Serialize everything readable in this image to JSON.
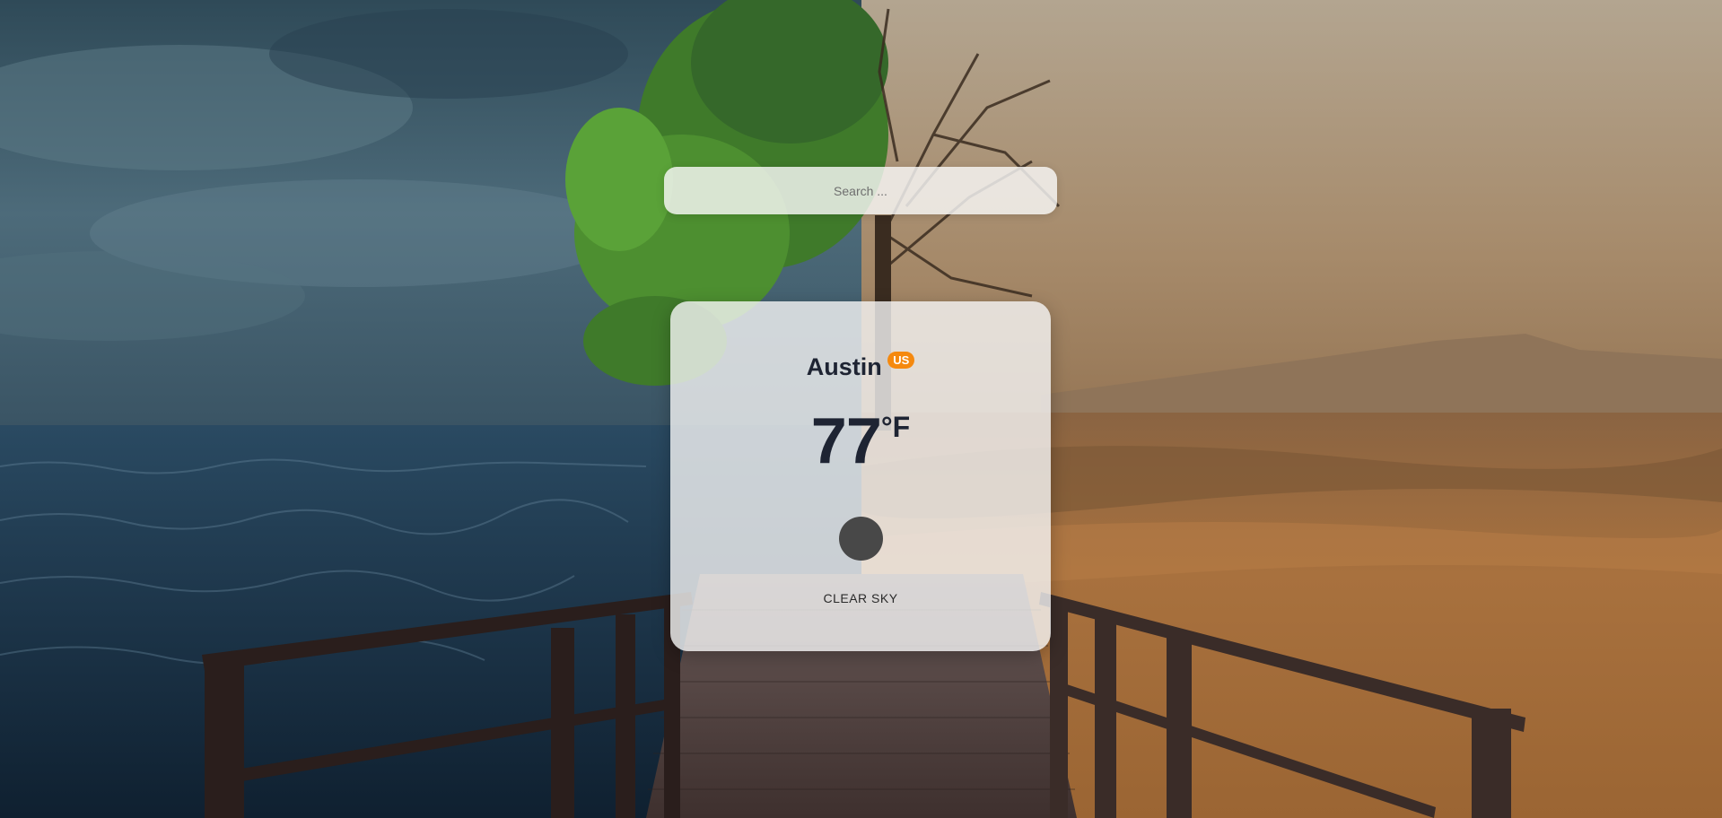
{
  "search": {
    "placeholder": "Search ...",
    "value": ""
  },
  "weather": {
    "city": "Austin",
    "country": "US",
    "temperature": "77",
    "unit": "°F",
    "icon": "clear-sky-icon",
    "description": "CLEAR SKY"
  },
  "colors": {
    "badge": "#f5890f",
    "text": "#1e2433",
    "icon": "#484848"
  }
}
